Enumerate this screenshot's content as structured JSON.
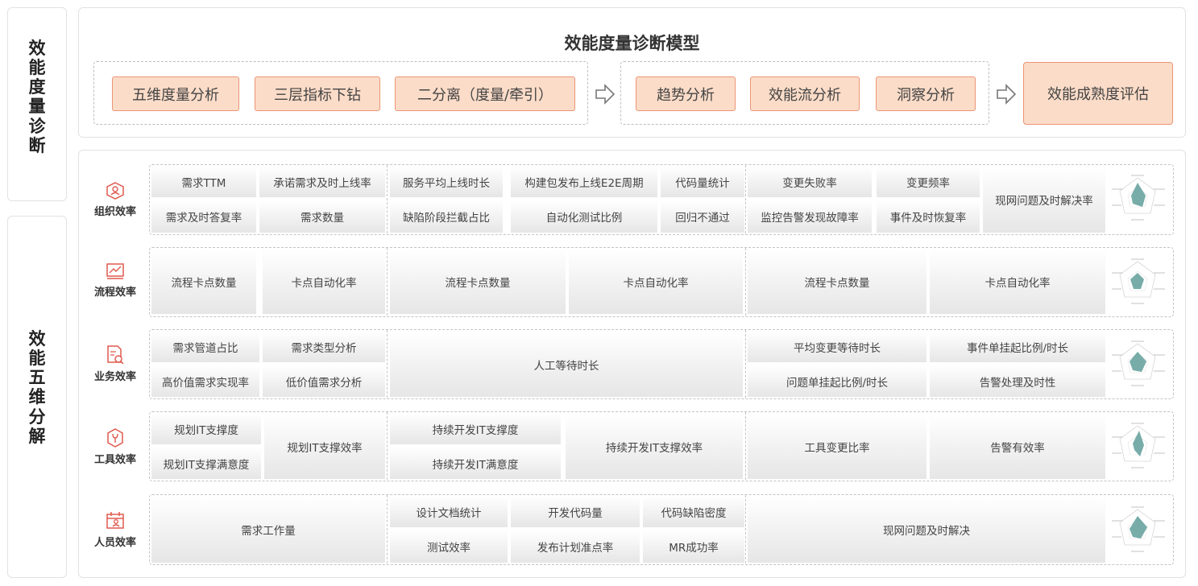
{
  "left_titles": {
    "top": [
      "效",
      "能",
      "度",
      "量",
      "诊",
      "断"
    ],
    "bottom": [
      "效",
      "能",
      "五",
      "维",
      "分",
      "解"
    ]
  },
  "header": {
    "title": "效能度量诊断模型",
    "group1": [
      "五维度量分析",
      "三层指标下钻",
      "二分离（度量/牵引）"
    ],
    "group2": [
      "趋势分析",
      "效能流分析",
      "洞察分析"
    ],
    "final": "效能成熟度评估"
  },
  "rows": [
    {
      "label": "组织效率",
      "icon": "organization-icon",
      "cells": [
        "需求TTM",
        "承诺需求及时上线率",
        "服务平均上线时长",
        "构建包发布上线E2E周期",
        "代码量统计",
        "需求及时答复率",
        "需求数量",
        "缺陷阶段拦截占比",
        "自动化测试比例",
        "回归不通过",
        "变更失败率",
        "变更频率",
        "监控告警发现故障率",
        "事件及时恢复率",
        "现网问题及时解决率"
      ]
    },
    {
      "label": "流程效率",
      "icon": "process-chart-icon",
      "cells": [
        "流程卡点数量",
        "卡点自动化率",
        "流程卡点数量",
        "卡点自动化率",
        "流程卡点数量",
        "卡点自动化率"
      ]
    },
    {
      "label": "业务效率",
      "icon": "business-analysis-icon",
      "cells": [
        "需求管道占比",
        "需求类型分析",
        "高价值需求实现率",
        "低价值需求分析",
        "人工等待时长",
        "平均变更等待时长",
        "事件单挂起比例/时长",
        "问题单挂起比例/时长",
        "告警处理及时性"
      ]
    },
    {
      "label": "工具效率",
      "icon": "tool-wrench-icon",
      "cells": [
        "规划IT支撑度",
        "规划IT支撑满意度",
        "规划IT支撑效率",
        "持续开发IT支撑度",
        "持续开发IT满意度",
        "持续开发IT支撑效率",
        "工具变更比率",
        "告警有效率"
      ]
    },
    {
      "label": "人员效率",
      "icon": "personnel-calendar-icon",
      "cells": [
        "需求工作量",
        "设计文档统计",
        "开发代码量",
        "代码缺陷密度",
        "测试效率",
        "发布计划准点率",
        "MR成功率",
        "现网问题及时解决"
      ]
    }
  ],
  "colors": {
    "tag_fill": "#fbdcc8",
    "tag_border": "#ec9576",
    "icon_red": "#e05a4f",
    "radar_fill": "#5f9e9a"
  }
}
